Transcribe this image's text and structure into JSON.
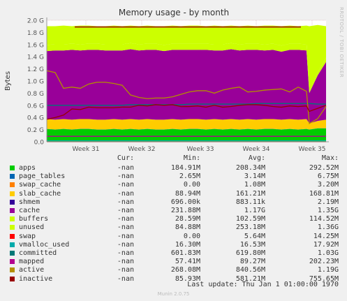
{
  "chart_data": {
    "type": "area",
    "title": "Memory usage - by month",
    "ylabel": "Bytes",
    "ylim": [
      0,
      2.0
    ],
    "y_unit": "G",
    "y_ticks": [
      "0.0",
      "0.2 G",
      "0.4 G",
      "0.6 G",
      "0.8 G",
      "1.0 G",
      "1.2 G",
      "1.4 G",
      "1.6 G",
      "1.8 G",
      "2.0 G"
    ],
    "x_ticks": [
      "Week 31",
      "Week 32",
      "Week 33",
      "Week 34",
      "Week 35"
    ],
    "x_tick_pos": [
      0.14,
      0.34,
      0.55,
      0.75,
      0.95
    ],
    "x_samples": [
      0,
      0.03,
      0.06,
      0.09,
      0.12,
      0.15,
      0.18,
      0.21,
      0.24,
      0.27,
      0.3,
      0.33,
      0.36,
      0.39,
      0.42,
      0.45,
      0.48,
      0.51,
      0.54,
      0.57,
      0.6,
      0.63,
      0.66,
      0.69,
      0.72,
      0.75,
      0.78,
      0.81,
      0.84,
      0.87,
      0.9,
      0.93,
      0.94,
      0.97,
      1.0
    ],
    "stacked_series": [
      {
        "name": "apps",
        "color": "#00cc00",
        "values": [
          0.21,
          0.2,
          0.21,
          0.2,
          0.21,
          0.21,
          0.2,
          0.2,
          0.21,
          0.2,
          0.21,
          0.2,
          0.21,
          0.2,
          0.2,
          0.21,
          0.2,
          0.21,
          0.21,
          0.2,
          0.21,
          0.2,
          0.21,
          0.2,
          0.21,
          0.2,
          0.21,
          0.21,
          0.2,
          0.21,
          0.2,
          0.21,
          0.2,
          0.22,
          0.22
        ]
      },
      {
        "name": "page_tables",
        "color": "#0066b3",
        "values": [
          0.003,
          0.003,
          0.003,
          0.003,
          0.003,
          0.003,
          0.003,
          0.003,
          0.003,
          0.003,
          0.003,
          0.003,
          0.003,
          0.003,
          0.003,
          0.003,
          0.003,
          0.003,
          0.003,
          0.003,
          0.003,
          0.003,
          0.003,
          0.003,
          0.003,
          0.003,
          0.003,
          0.003,
          0.003,
          0.003,
          0.003,
          0.003,
          0.003,
          0.003,
          0.003
        ]
      },
      {
        "name": "swap_cache",
        "color": "#ff8000",
        "values": [
          0,
          0,
          0,
          0,
          0,
          0,
          0,
          0,
          0,
          0,
          0,
          0,
          0,
          0,
          0,
          0,
          0,
          0,
          0,
          0,
          0,
          0,
          0,
          0,
          0,
          0,
          0,
          0,
          0,
          0,
          0,
          0,
          0,
          0,
          0
        ]
      },
      {
        "name": "slab_cache",
        "color": "#ffcc00",
        "values": [
          0.16,
          0.16,
          0.16,
          0.16,
          0.16,
          0.16,
          0.16,
          0.16,
          0.16,
          0.16,
          0.16,
          0.16,
          0.16,
          0.16,
          0.16,
          0.16,
          0.16,
          0.16,
          0.16,
          0.16,
          0.16,
          0.16,
          0.16,
          0.16,
          0.16,
          0.16,
          0.16,
          0.16,
          0.16,
          0.16,
          0.16,
          0.16,
          0.1,
          0.12,
          0.14
        ]
      },
      {
        "name": "shmem",
        "color": "#330099",
        "values": [
          0,
          0,
          0,
          0,
          0,
          0,
          0,
          0,
          0,
          0,
          0,
          0,
          0,
          0,
          0,
          0,
          0,
          0,
          0,
          0,
          0,
          0,
          0,
          0,
          0,
          0,
          0,
          0,
          0,
          0,
          0,
          0,
          0,
          0,
          0
        ]
      },
      {
        "name": "cache",
        "color": "#990099",
        "values": [
          1.12,
          1.14,
          1.13,
          1.15,
          1.13,
          1.14,
          1.15,
          1.14,
          1.13,
          1.14,
          1.15,
          1.14,
          1.14,
          1.15,
          1.13,
          1.14,
          1.15,
          1.14,
          1.14,
          1.15,
          1.13,
          1.14,
          1.15,
          1.14,
          1.14,
          1.15,
          1.13,
          1.14,
          1.12,
          1.14,
          1.15,
          1.13,
          0.5,
          0.75,
          0.95
        ]
      },
      {
        "name": "buffers",
        "color": "#ccff00",
        "values": [
          0.1,
          0.1,
          0.1,
          0.1,
          0.1,
          0.1,
          0.1,
          0.1,
          0.1,
          0.1,
          0.1,
          0.1,
          0.1,
          0.1,
          0.1,
          0.1,
          0.1,
          0.1,
          0.1,
          0.1,
          0.1,
          0.1,
          0.1,
          0.1,
          0.1,
          0.1,
          0.1,
          0.1,
          0.1,
          0.1,
          0.1,
          0.1,
          0.03,
          0.05,
          0.07
        ]
      },
      {
        "name": "unused",
        "color": "#ccff00",
        "values": [
          0.31,
          0.3,
          0.31,
          0.29,
          0.31,
          0.3,
          0.29,
          0.3,
          0.31,
          0.3,
          0.29,
          0.3,
          0.3,
          0.29,
          0.31,
          0.3,
          0.29,
          0.3,
          0.3,
          0.29,
          0.31,
          0.3,
          0.29,
          0.3,
          0.3,
          0.29,
          0.31,
          0.3,
          0.32,
          0.3,
          0.29,
          0.31,
          1.07,
          0.78,
          0.52
        ]
      }
    ],
    "line_series": [
      {
        "name": "swap",
        "color": "#ff0000",
        "values": [
          0,
          0,
          0,
          0,
          0,
          0,
          0,
          0,
          0,
          0,
          0,
          0,
          0,
          0,
          0,
          0,
          0,
          0,
          0,
          0,
          0,
          0,
          0,
          0,
          0,
          0,
          0,
          0,
          0,
          0,
          0,
          0,
          0,
          0,
          0
        ]
      },
      {
        "name": "vmalloc_used",
        "color": "#00aaaa",
        "values": [
          0.017,
          0.017,
          0.017,
          0.017,
          0.017,
          0.017,
          0.017,
          0.017,
          0.017,
          0.017,
          0.017,
          0.017,
          0.017,
          0.017,
          0.017,
          0.017,
          0.017,
          0.017,
          0.017,
          0.017,
          0.017,
          0.017,
          0.017,
          0.017,
          0.017,
          0.017,
          0.017,
          0.017,
          0.017,
          0.017,
          0.017,
          0.017,
          0.017,
          0.017,
          0.017
        ]
      },
      {
        "name": "committed",
        "color": "#007777",
        "values": [
          0.6,
          0.6,
          0.6,
          0.6,
          0.6,
          0.6,
          0.6,
          0.6,
          0.6,
          0.6,
          0.61,
          0.61,
          0.61,
          0.61,
          0.61,
          0.61,
          0.61,
          0.62,
          0.62,
          0.62,
          0.62,
          0.62,
          0.62,
          0.62,
          0.62,
          0.63,
          0.63,
          0.63,
          0.63,
          0.63,
          0.63,
          0.63,
          0.63,
          0.62,
          0.62
        ]
      },
      {
        "name": "mapped",
        "color": "#b3008f",
        "values": [
          0.09,
          0.09,
          0.09,
          0.09,
          0.09,
          0.09,
          0.09,
          0.09,
          0.09,
          0.09,
          0.09,
          0.09,
          0.09,
          0.09,
          0.09,
          0.09,
          0.09,
          0.09,
          0.09,
          0.09,
          0.09,
          0.09,
          0.09,
          0.09,
          0.09,
          0.09,
          0.09,
          0.09,
          0.09,
          0.09,
          0.09,
          0.09,
          0.09,
          0.09,
          0.09
        ]
      },
      {
        "name": "active",
        "color": "#b38f00",
        "values": [
          1.17,
          1.14,
          0.88,
          0.9,
          0.88,
          0.95,
          0.98,
          0.98,
          0.96,
          0.93,
          0.77,
          0.73,
          0.71,
          0.72,
          0.72,
          0.74,
          0.78,
          0.82,
          0.84,
          0.84,
          0.8,
          0.85,
          0.88,
          0.9,
          0.82,
          0.83,
          0.85,
          0.86,
          0.87,
          0.82,
          0.9,
          0.83,
          0.3,
          0.38,
          0.58
        ]
      },
      {
        "name": "inactive",
        "color": "#990000",
        "values": [
          0.37,
          0.4,
          0.44,
          0.54,
          0.53,
          0.57,
          0.56,
          0.56,
          0.56,
          0.57,
          0.57,
          0.6,
          0.59,
          0.61,
          0.6,
          0.61,
          0.58,
          0.58,
          0.59,
          0.57,
          0.6,
          0.57,
          0.58,
          0.6,
          0.61,
          0.61,
          0.6,
          0.58,
          0.57,
          0.59,
          0.58,
          0.59,
          0.5,
          0.55,
          0.6
        ]
      }
    ],
    "top_line": {
      "color": "#990000",
      "value": 1.89
    }
  },
  "legend": {
    "headers": {
      "cur": "Cur:",
      "min": "Min:",
      "avg": "Avg:",
      "max": "Max:"
    },
    "rows": [
      {
        "name": "apps",
        "color": "#00cc00",
        "cur": "-nan",
        "min": "184.91M",
        "avg": "208.34M",
        "max": "292.52M"
      },
      {
        "name": "page_tables",
        "color": "#0066b3",
        "cur": "-nan",
        "min": "2.65M",
        "avg": "3.14M",
        "max": "6.75M"
      },
      {
        "name": "swap_cache",
        "color": "#ff8000",
        "cur": "-nan",
        "min": "0.00",
        "avg": "1.08M",
        "max": "3.20M"
      },
      {
        "name": "slab_cache",
        "color": "#ffcc00",
        "cur": "-nan",
        "min": "88.94M",
        "avg": "161.21M",
        "max": "168.81M"
      },
      {
        "name": "shmem",
        "color": "#330099",
        "cur": "-nan",
        "min": "696.00k",
        "avg": "883.11k",
        "max": "2.19M"
      },
      {
        "name": "cache",
        "color": "#990099",
        "cur": "-nan",
        "min": "231.88M",
        "avg": "1.17G",
        "max": "1.35G"
      },
      {
        "name": "buffers",
        "color": "#ccff00",
        "cur": "-nan",
        "min": "28.59M",
        "avg": "102.59M",
        "max": "114.52M"
      },
      {
        "name": "unused",
        "color": "#ccff00",
        "cur": "-nan",
        "min": "84.88M",
        "avg": "253.18M",
        "max": "1.36G"
      },
      {
        "name": "swap",
        "color": "#ff0000",
        "cur": "-nan",
        "min": "0.00",
        "avg": "5.64M",
        "max": "14.25M"
      },
      {
        "name": "vmalloc_used",
        "color": "#00aaaa",
        "cur": "-nan",
        "min": "16.30M",
        "avg": "16.53M",
        "max": "17.92M"
      },
      {
        "name": "committed",
        "color": "#007777",
        "cur": "-nan",
        "min": "601.83M",
        "avg": "619.80M",
        "max": "1.03G"
      },
      {
        "name": "mapped",
        "color": "#b3008f",
        "cur": "-nan",
        "min": "57.41M",
        "avg": "89.27M",
        "max": "202.23M"
      },
      {
        "name": "active",
        "color": "#b38f00",
        "cur": "-nan",
        "min": "268.08M",
        "avg": "840.56M",
        "max": "1.19G"
      },
      {
        "name": "inactive",
        "color": "#990000",
        "cur": "-nan",
        "min": "85.93M",
        "avg": "581.21M",
        "max": "755.65M"
      }
    ]
  },
  "last_update": "Last update: Thu Jan  1 01:00:00 1970",
  "footer": "Munin 2.0.75",
  "side_text": "RRDTOOL / TOBI OETIKER"
}
